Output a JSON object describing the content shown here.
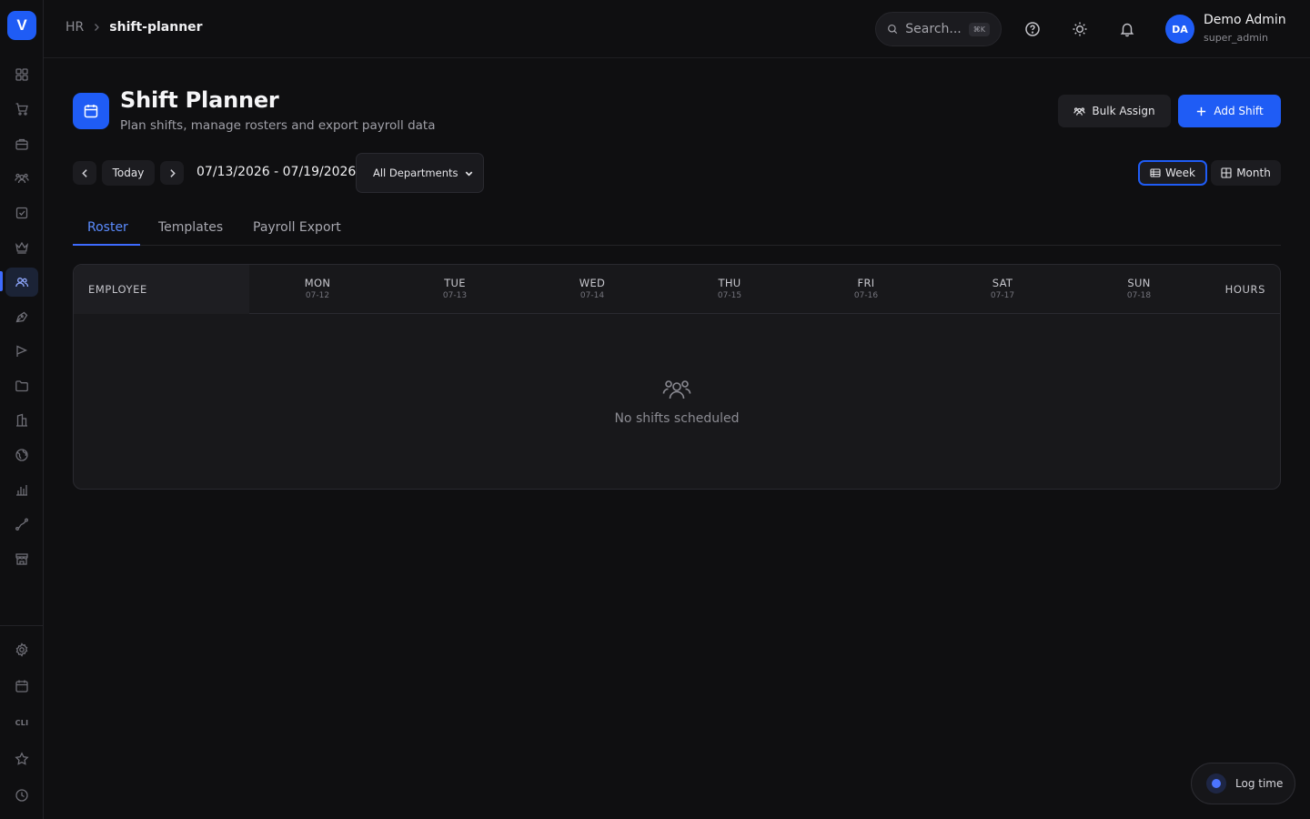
{
  "app": {
    "logo_letter": "V",
    "accent": "#1f5cf5",
    "cli_label": "CLI"
  },
  "breadcrumb": {
    "root": "HR",
    "current": "shift-planner"
  },
  "search": {
    "placeholder": "Search...",
    "shortcut": "⌘K"
  },
  "user": {
    "initials": "DA",
    "name": "Demo Admin",
    "role": "super_admin"
  },
  "page": {
    "title": "Shift Planner",
    "subtitle": "Plan shifts, manage rosters and export payroll data",
    "bulk_assign_label": "Bulk Assign",
    "add_shift_label": "Add Shift"
  },
  "filters": {
    "today_label": "Today",
    "date_range": "07/13/2026 - 07/19/2026",
    "department_selected": "All Departments",
    "view_week_label": "Week",
    "view_month_label": "Month",
    "active_view": "week"
  },
  "tabs": [
    {
      "label": "Roster",
      "active": true
    },
    {
      "label": "Templates",
      "active": false
    },
    {
      "label": "Payroll Export",
      "active": false
    }
  ],
  "roster": {
    "employee_header": "EMPLOYEE",
    "hours_header": "HOURS",
    "days": [
      {
        "name": "MON",
        "date": "07-12"
      },
      {
        "name": "TUE",
        "date": "07-13"
      },
      {
        "name": "WED",
        "date": "07-14"
      },
      {
        "name": "THU",
        "date": "07-15"
      },
      {
        "name": "FRI",
        "date": "07-16"
      },
      {
        "name": "SAT",
        "date": "07-17"
      },
      {
        "name": "SUN",
        "date": "07-18"
      }
    ],
    "empty_text": "No shifts scheduled"
  },
  "log_time": {
    "label": "Log time"
  }
}
